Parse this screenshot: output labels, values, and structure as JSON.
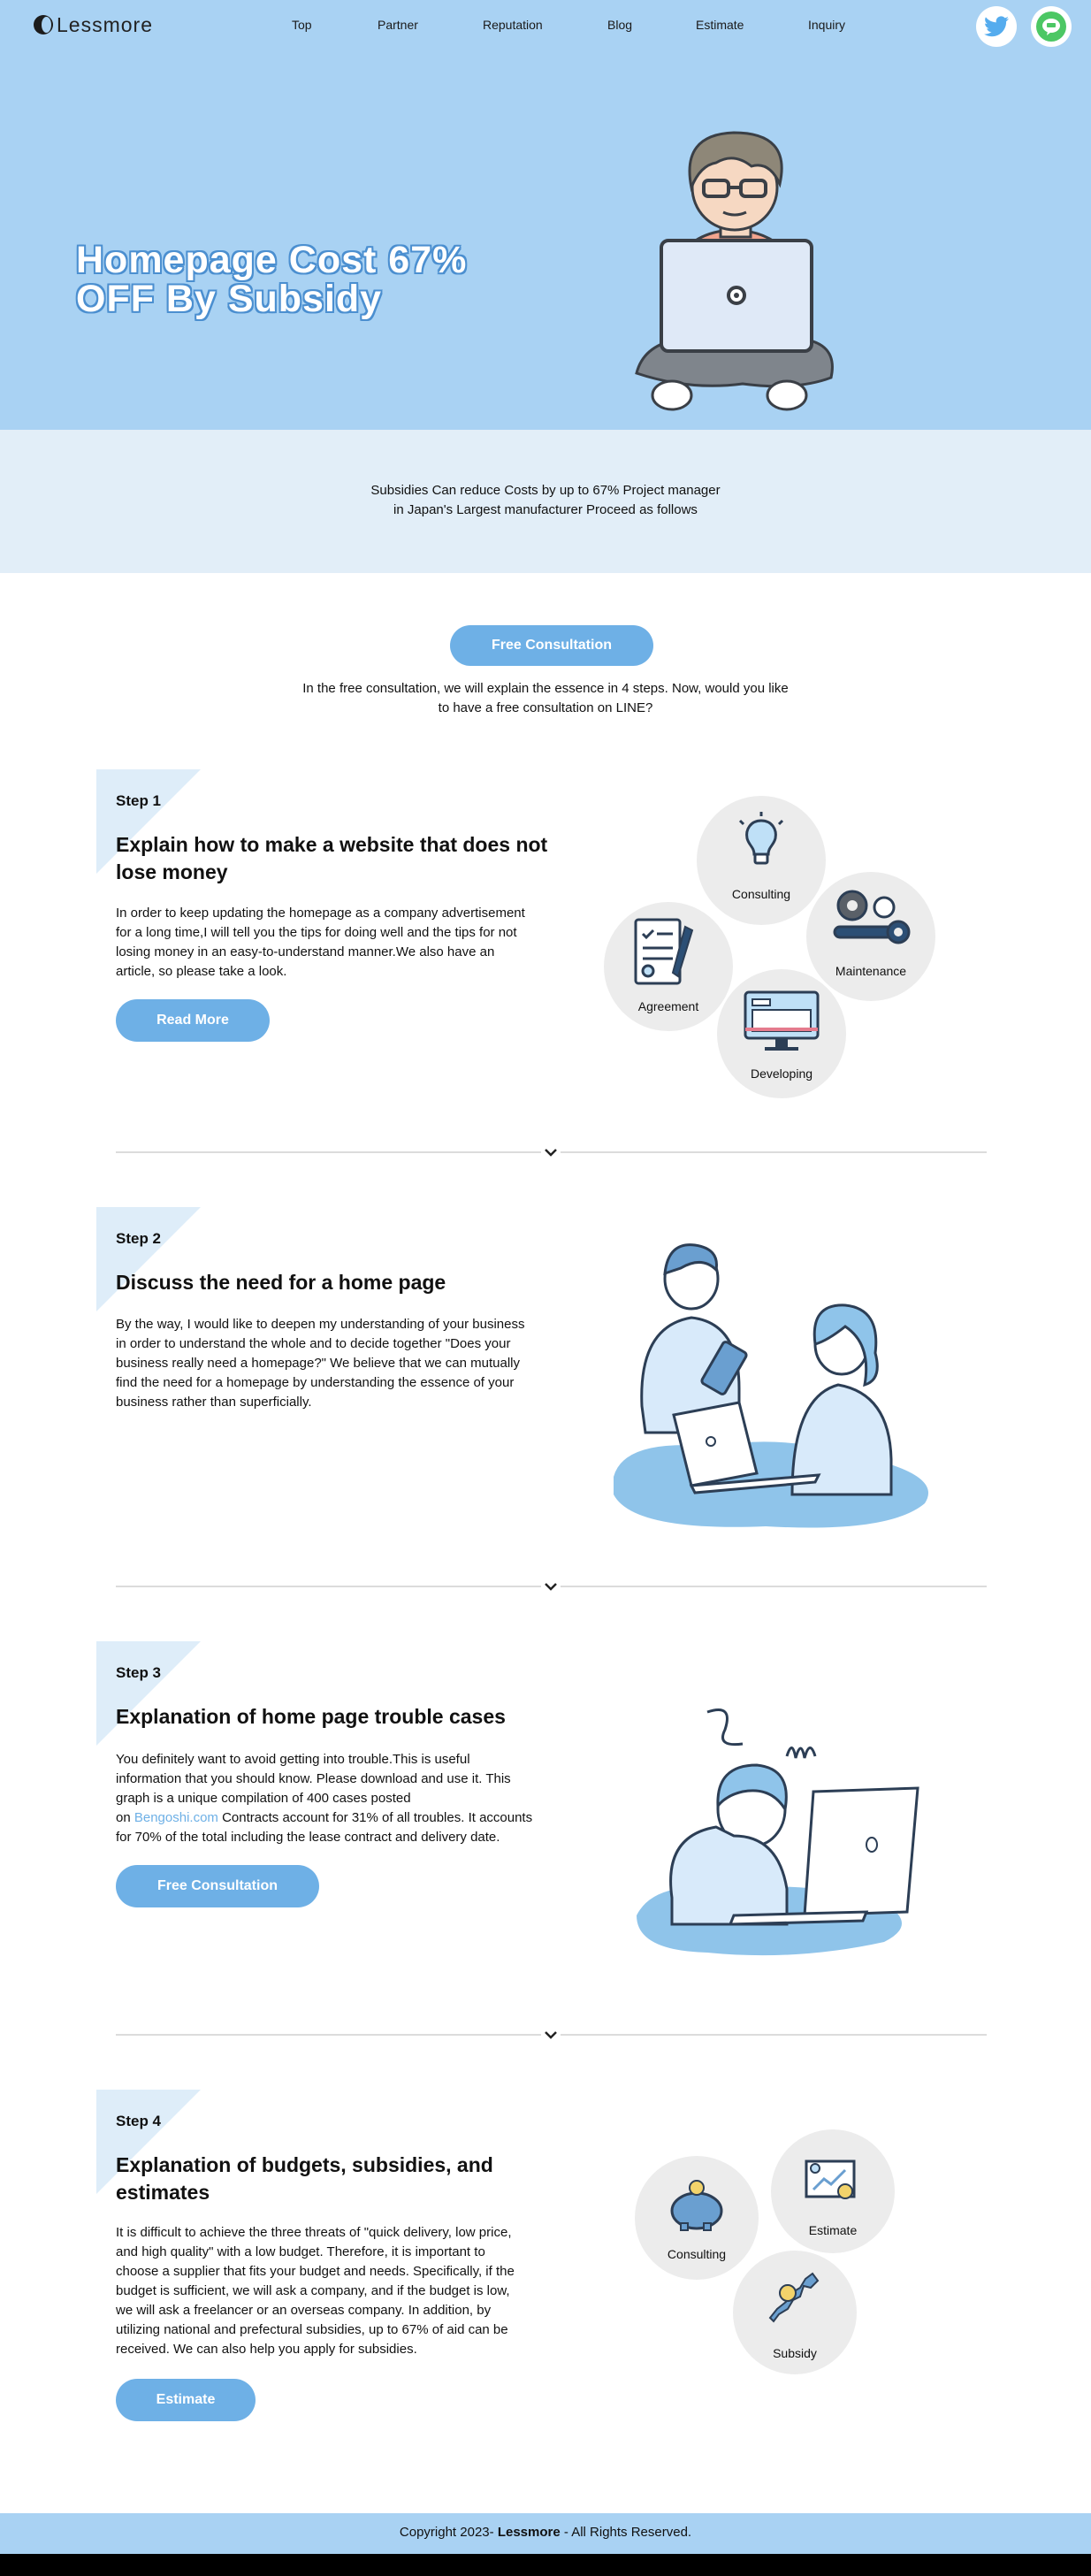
{
  "header": {
    "logo_text": "Lessmore",
    "nav": [
      "Top",
      "Partner",
      "Reputation",
      "Blog",
      "Estimate",
      "Inquiry"
    ],
    "social": [
      "twitter-icon",
      "line-icon"
    ]
  },
  "hero": {
    "title_line1": "Homepage Cost 67%",
    "title_line2": "OFF By Subsidy"
  },
  "band": {
    "line1": "Subsidies Can reduce Costs by up to 67% Project manager",
    "line2": "in Japan's Largest manufacturer Proceed as follows"
  },
  "cta": {
    "button": "Free Consultation",
    "line1": "In the free consultation, we will explain the essence in 4 steps. Now, would you like",
    "line2": "to have a free consultation on LINE?"
  },
  "step1": {
    "label": "Step 1",
    "title_l1": "Explain how to make a website that does not",
    "title_l2": "lose money",
    "p1": "In order to keep updating the homepage as a company advertisement",
    "p2": "for a long time,I will tell you the tips for doing well and the tips for not",
    "p3": "losing money in an easy-to-understand manner.We also have an",
    "p4": "article, so please take a look.",
    "button": "Read More",
    "circles": [
      "Consulting",
      "Maintenance",
      "Agreement",
      "Developing"
    ]
  },
  "step2": {
    "label": "Step 2",
    "title": "Discuss the need for a home page",
    "p1": "By the way, I would like to deepen my understanding of your business",
    "p2": "in order to understand the whole and to decide together \"Does your",
    "p3": "business really need a homepage?\" We believe that we can mutually",
    "p4": "find the need for a homepage by understanding the essence of your",
    "p5": "business rather than superficially."
  },
  "step3": {
    "label": "Step 3",
    "title": "Explanation of home page trouble cases",
    "p1": "You definitely want to avoid getting into trouble.This is useful",
    "p2": "information that you should know. Please download and use it. This",
    "p3": "graph is a unique compilation of 400 cases posted",
    "p4_pre": "on ",
    "p4_link": "Bengoshi.com",
    "p4_post": " Contracts account for 31% of all troubles. It accounts",
    "p5": "for 70% of the total including the lease contract and delivery date.",
    "button": "Free Consultation"
  },
  "step4": {
    "label": "Step 4",
    "title_l1": "Explanation of budgets, subsidies, and",
    "title_l2": "estimates",
    "p1": "It is difficult to achieve the three threats of \"quick delivery, low price,",
    "p2": "and high quality\" with a low budget. Therefore, it is important to",
    "p3": "choose a supplier that fits your budget and needs. Specifically, if the",
    "p4": "budget is sufficient, we will ask a company, and if the budget is low,",
    "p5": "we will ask a freelancer or an overseas company. In addition, by",
    "p6": "utilizing national and prefectural subsidies, up to 67% of aid can be",
    "p7": "received. We can also help you apply for subsidies.",
    "button": "Estimate",
    "circles": [
      "Consulting",
      "Estimate",
      "Subsidy"
    ]
  },
  "footer": {
    "pre": "Copyright 2023- ",
    "brand": "Lessmore",
    "post": " - All Rights Reserved."
  },
  "colors": {
    "header_bg": "#a9d2f3",
    "band_bg": "#e2eef8",
    "accent": "#6eb0e6",
    "twitter": "#55acee",
    "line": "#4cc764"
  }
}
